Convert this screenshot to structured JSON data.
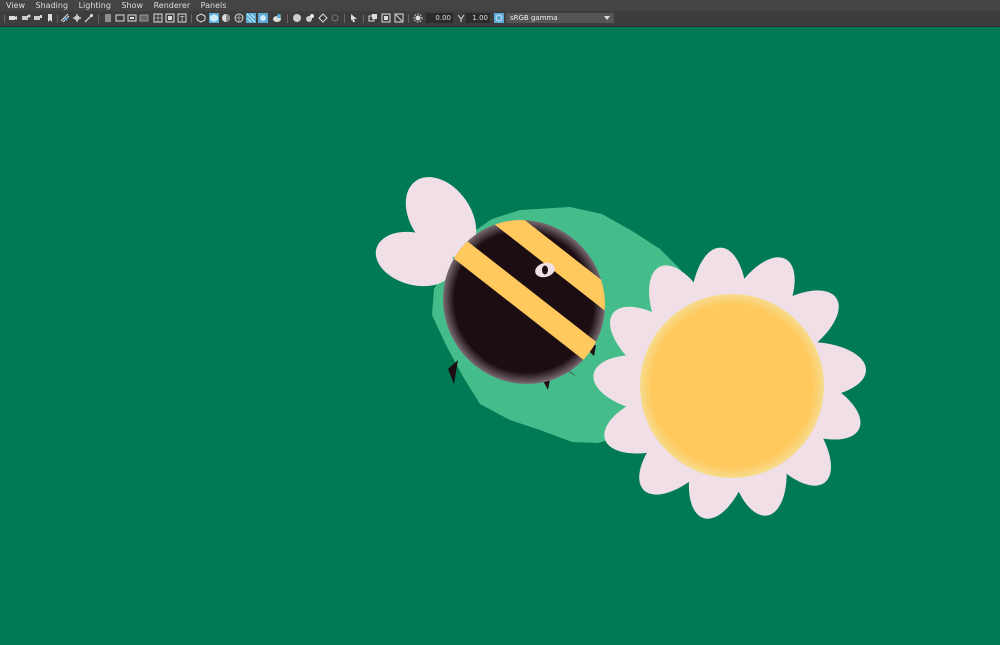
{
  "menu": [
    "View",
    "Shading",
    "Lighting",
    "Show",
    "Renderer",
    "Panels"
  ],
  "toolbar": {
    "exposure": "0.00",
    "gamma": "1.00",
    "color_management": "sRGB gamma"
  },
  "colors": {
    "viewport_bg": "#007a55",
    "shadow": "#45bd8b",
    "petal": "#f0dfe6",
    "flower_center": "#ffc95e",
    "bee_body": "#1b0d12",
    "bee_stripe": "#ffc95e",
    "accent_blue": "#5aa9d6"
  },
  "icons": [
    "camera-icon",
    "camera-attr-icon",
    "bookmark-icon",
    "image-plane-icon",
    "grid-icon",
    "film-gate-icon",
    "resolution-gate-icon",
    "gate-mask-icon",
    "field-chart-icon",
    "safe-action-icon",
    "safe-title-icon",
    "wireframe-icon",
    "smooth-shade-icon",
    "wireframe-on-shaded-icon",
    "textured-icon",
    "use-all-lights-icon",
    "shadows-icon",
    "screen-space-ao-icon",
    "motion-blur-icon",
    "multisample-aa-icon",
    "isolate-select-icon",
    "xray-icon",
    "xray-joints-icon",
    "backface-cull-icon",
    "exposure-icon",
    "gamma-icon",
    "color-management-icon"
  ]
}
